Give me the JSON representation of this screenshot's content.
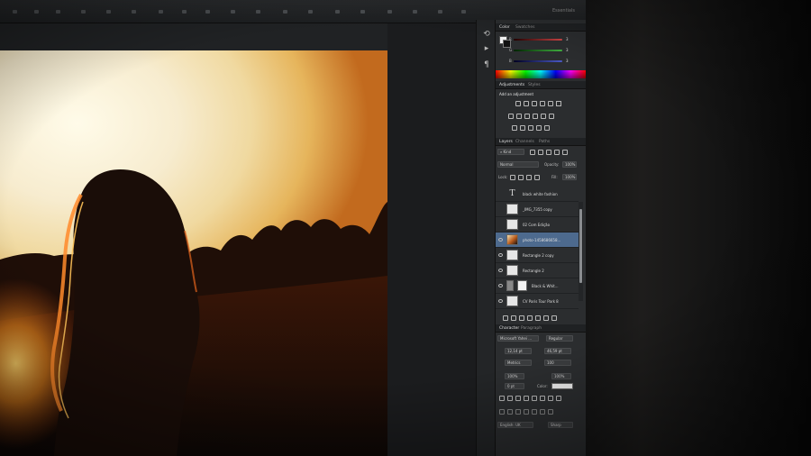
{
  "app": {
    "title": "Essentials"
  },
  "color_panel": {
    "tabs": [
      "Color",
      "Swatches"
    ],
    "sliders": [
      {
        "label": "R",
        "value": "3",
        "color": "#d04545"
      },
      {
        "label": "G",
        "value": "3",
        "color": "#41b141"
      },
      {
        "label": "B",
        "value": "3",
        "color": "#4a59c6"
      }
    ]
  },
  "adjustments_panel": {
    "tabs": [
      "Adjustments",
      "Styles"
    ],
    "hint": "Add an adjustment"
  },
  "layers_panel": {
    "tabs": [
      "Layers",
      "Channels",
      "Paths"
    ],
    "filter_kind": "Kind",
    "blend_mode": "Normal",
    "opacity_label": "Opacity:",
    "opacity_value": "100%",
    "lock_label": "Lock:",
    "fill_label": "Fill:",
    "fill_value": "100%",
    "layers": [
      {
        "name": "black white fashion",
        "thumb": "text",
        "visible": false,
        "selected": false
      },
      {
        "name": "_IMG_7355 copy",
        "thumb": "white",
        "visible": false,
        "selected": false
      },
      {
        "name": "02 Com Edição",
        "thumb": "white",
        "visible": false,
        "selected": false
      },
      {
        "name": "photo-1458686658...",
        "thumb": "photo",
        "visible": true,
        "selected": true
      },
      {
        "name": "Rectangle 2 copy",
        "thumb": "white",
        "visible": true,
        "selected": false
      },
      {
        "name": "Rectangle 2",
        "thumb": "white",
        "visible": true,
        "selected": false
      },
      {
        "name": "Black & Whit...",
        "thumb": "adjust",
        "visible": true,
        "selected": false
      },
      {
        "name": "CV Paris Tour Park 8",
        "thumb": "white",
        "visible": true,
        "selected": false
      }
    ]
  },
  "character_panel": {
    "tabs": [
      "Character",
      "Paragraph"
    ],
    "font_family": "Microsoft Yahei ...",
    "font_style": "Regular",
    "font_size": "12,14 pt",
    "leading": "46,59 pt",
    "kerning": "Metrics",
    "tracking": "100",
    "vertical_scale": "100%",
    "horizontal_scale": "100%",
    "baseline_shift": "0 pt",
    "color_label": "Color:",
    "language": "English: UK",
    "anti_alias": "Sharp"
  },
  "colors": {
    "panel_bg": "#2b2d2f",
    "selected_layer": "#4d6a8e",
    "accent_sunset": "#e8892a"
  }
}
